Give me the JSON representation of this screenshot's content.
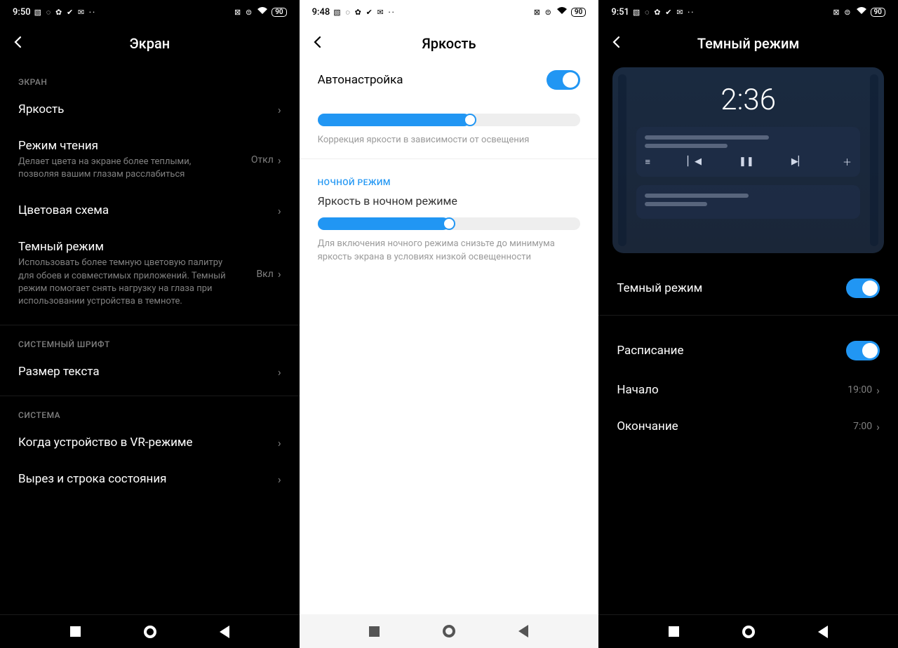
{
  "status_icons_left": "▧ ◌ ✿ ✔ ✉ ··",
  "status_icons_right": "⊠ ⊜",
  "battery": "90",
  "screen1": {
    "time": "9:50",
    "title": "Экран",
    "section1": "ЭКРАН",
    "brightness": "Яркость",
    "reading_title": "Режим чтения",
    "reading_sub": "Делает цвета на экране более теплыми, позволяя вашим глазам расслабиться",
    "reading_val": "Откл",
    "color_scheme": "Цветовая схема",
    "dark_title": "Темный режим",
    "dark_sub": "Использовать более темную цветовую палитру для обоев и совместимых приложений. Темный режим помогает снять нагрузку на глаза при использовании устройства в темноте.",
    "dark_val": "Вкл",
    "section2": "СИСТЕМНЫЙ ШРИФТ",
    "text_size": "Размер текста",
    "section3": "СИСТЕМА",
    "vr": "Когда устройство в VR-режиме",
    "notch": "Вырез и строка состояния"
  },
  "screen2": {
    "time": "9:48",
    "title": "Яркость",
    "auto": "Автонастройка",
    "slider1_pct": 58,
    "hint1": "Коррекция яркости в зависимости от освещения",
    "section": "НОЧНОЙ РЕЖИМ",
    "night_label": "Яркость в ночном режиме",
    "slider2_pct": 50,
    "hint2": "Для включения ночного режима снизьте до минимума яркость экрана в условиях низкой освещенности"
  },
  "screen3": {
    "time": "9:51",
    "title": "Темный режим",
    "preview_clock": "2:36",
    "dark_mode": "Темный режим",
    "schedule": "Расписание",
    "start": "Начало",
    "start_val": "19:00",
    "end": "Окончание",
    "end_val": "7:00"
  }
}
